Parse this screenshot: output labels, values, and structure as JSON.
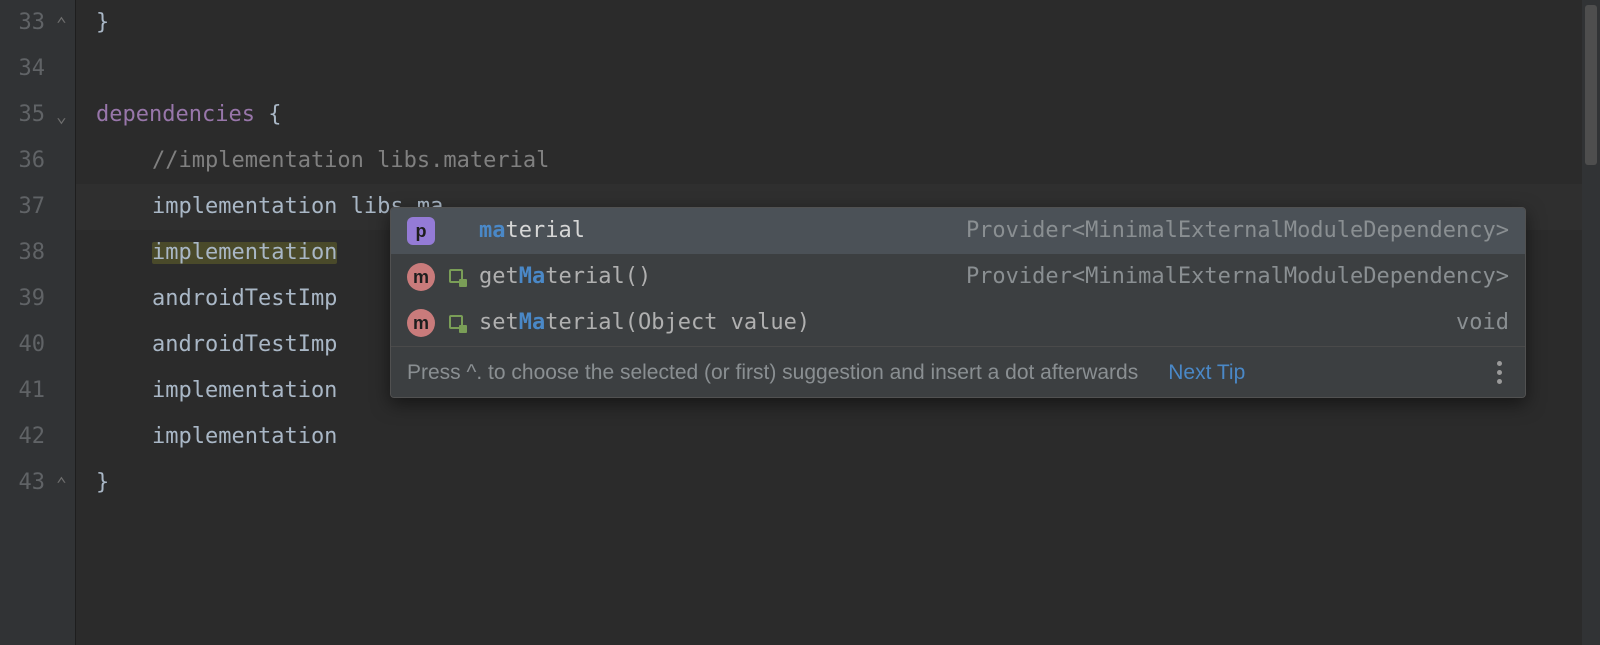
{
  "gutter": {
    "start": 33,
    "end": 43,
    "folds": {
      "33": "end",
      "35": "start",
      "43": "end"
    }
  },
  "code": {
    "33": {
      "indent": 0,
      "brace_close": "}"
    },
    "34": {
      "indent": 0,
      "blank": true
    },
    "35": {
      "dep_word": "dependencies",
      "brace_open": " {"
    },
    "36": {
      "comment": "//implementation libs.material"
    },
    "37": {
      "stmt_kw": "implementation",
      "stmt_rest": " libs.ma"
    },
    "38": {
      "stmt_hl": "implementation"
    },
    "39": {
      "stmt_partial": "androidTestImp"
    },
    "40": {
      "stmt_partial": "androidTestImp"
    },
    "41": {
      "stmt_partial": "implementation"
    },
    "42": {
      "stmt_partial": "implementation"
    },
    "43": {
      "indent": 0,
      "brace_close": "}"
    }
  },
  "popup": {
    "items": [
      {
        "icon": "p",
        "pre": "ma",
        "rest": "terial",
        "params": "",
        "sub": false,
        "type": "Provider<MinimalExternalModuleDependency>"
      },
      {
        "icon": "m",
        "pre2": "get",
        "mid": "Ma",
        "post": "terial",
        "params": "()",
        "sub": true,
        "type": "Provider<MinimalExternalModuleDependency>"
      },
      {
        "icon": "m",
        "pre2": "set",
        "mid": "Ma",
        "post": "terial",
        "params": "(Object value)",
        "sub": true,
        "type": "void"
      }
    ],
    "footer_hint": "Press ^. to choose the selected (or first) suggestion and insert a dot afterwards",
    "footer_link": "Next Tip"
  }
}
